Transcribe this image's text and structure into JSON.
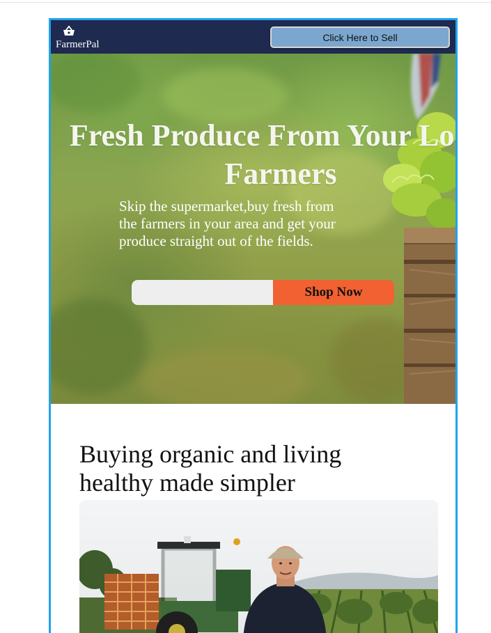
{
  "navbar": {
    "brand": "FarmerPal",
    "brand_icon": "basket-icon",
    "sell_button_label": "Click Here to Sell",
    "background": "#1e2a4f",
    "button_color": "#7ba7cf"
  },
  "hero": {
    "title": "Fresh Produce From Your Local Farmers",
    "subtitle": "Skip the supermarket,buy fresh from the farmers in your area and get your produce straight out of the fields.",
    "input_placeholder": "",
    "shop_button_label": "Shop Now",
    "accent": "#f26131"
  },
  "section": {
    "title": "Buying organic and living healthy made simpler",
    "image": "farmer-with-tractor-image"
  },
  "frame_border_color": "#1fa3ec"
}
